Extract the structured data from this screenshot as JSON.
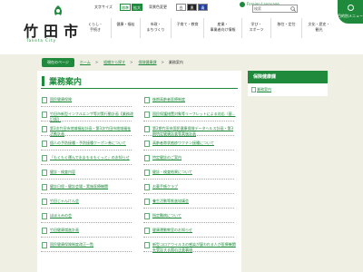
{
  "header": {
    "logo": {
      "name": "竹田市",
      "sub": "Taketa City"
    },
    "tools": {
      "font_size_label": "文字サイズ",
      "font_standard": "標準",
      "font_large": "拡大",
      "bg_color_label": "背景色変更",
      "bg_white": "白",
      "bg_black": "黒",
      "bg_blue": "青"
    },
    "language": "Foreign Language",
    "search": {
      "value": "",
      "placeholder": "検索"
    },
    "badge": "目的別メニュー",
    "nav": [
      {
        "label": "くらし・\n手続き"
      },
      {
        "label": "健康・福祉"
      },
      {
        "label": "市政・\nまちづくり"
      },
      {
        "label": "子育て・教育"
      },
      {
        "label": "産業・\n事業者向け情報"
      },
      {
        "label": "学び・\nスポーツ"
      },
      {
        "label": "移住・定住"
      },
      {
        "label": "文化・歴史・\n観光"
      }
    ]
  },
  "breadcrumb": {
    "first": "現在のページ",
    "links": [
      "ホーム",
      "組織から探す",
      "保険健康課"
    ],
    "current": "業務案内"
  },
  "main": {
    "title": "業務案内",
    "items": [
      {
        "text": "国民健康保険"
      },
      {
        "text": "後期高齢者医療制度"
      },
      {
        "text": "竹田市新型インフルエンザ等対策行動計画【業務改訂版】"
      },
      {
        "text": "国民保護措置対象等リーフレットによる対応（基..."
      },
      {
        "text": "第3次竹田市地域福祉計画・第3次竹田市地域福祉活動計画"
      },
      {
        "text": "第2期竹田市国民健康保険データヘルス計画・第3期特定健康診査等実施計画"
      },
      {
        "text": "個人の予防接種・予防接種クーポン券について"
      },
      {
        "text": "高齢者帯状疱疹ワクチン接種について"
      },
      {
        "text": "「もくもく運んで水まもるもくっと」のお知らせ"
      },
      {
        "text": "特定健診のご案内"
      },
      {
        "text": "健診・検査内容"
      },
      {
        "text": "健診・検査結果について"
      },
      {
        "text": "健診日程・健診会場・実施医療機関"
      },
      {
        "text": "お薬手帳クラブ"
      },
      {
        "text": "竹田じゃんけん会"
      },
      {
        "text": "養生活動等推進協議会"
      },
      {
        "text": "ほほえみの会"
      },
      {
        "text": "指定難病について"
      },
      {
        "text": "竹田健康増進計画"
      },
      {
        "text": "健康運動教室のお知らせ"
      },
      {
        "text": "国民健康保険制度改正一覧"
      },
      {
        "text": "新型コロナウイルスの感染が疑われる人が医療機関を受診する際の注意事項"
      }
    ]
  },
  "side": {
    "heading": "保険健康課",
    "link": "業務案内"
  },
  "colors": {
    "accent": "#1f8a3c",
    "page_bg": "#f0efe4"
  }
}
